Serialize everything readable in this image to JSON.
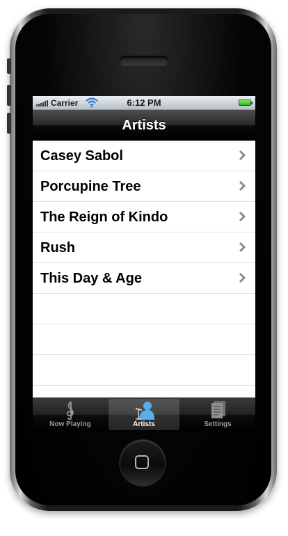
{
  "status_bar": {
    "carrier": "Carrier",
    "time": "6:12 PM"
  },
  "nav": {
    "title": "Artists"
  },
  "artists": [
    {
      "label": "Casey Sabol"
    },
    {
      "label": "Porcupine Tree"
    },
    {
      "label": "The Reign of Kindo"
    },
    {
      "label": "Rush"
    },
    {
      "label": "This Day & Age"
    }
  ],
  "tabs": [
    {
      "label": "Now Playing",
      "icon": "treble-clef-icon",
      "selected": false
    },
    {
      "label": "Artists",
      "icon": "artist-microphone-icon",
      "selected": true
    },
    {
      "label": "Settings",
      "icon": "settings-document-icon",
      "selected": false
    }
  ],
  "colors": {
    "tab_selected": "#ffffff",
    "tab_unselected": "#9a9a9a",
    "battery": "#2fb516",
    "artist_icon": "#5aaee8"
  }
}
